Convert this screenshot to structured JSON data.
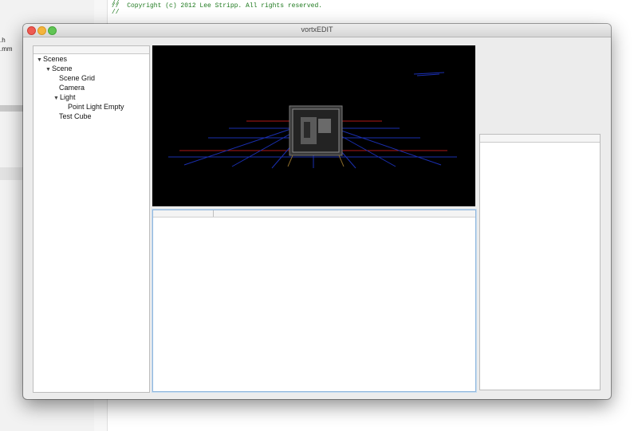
{
  "background_editor": {
    "code_lines": [
      "//",
      "//  Copyright (c) 2012 Lee Stripp. All rights reserved.",
      "//"
    ],
    "sidebar_files": [
      ".h",
      ".mm"
    ]
  },
  "window": {
    "title": "vortxEDIT"
  },
  "outline": {
    "items": [
      {
        "label": "Scenes",
        "expanded": true
      },
      {
        "label": "Scene",
        "expanded": true
      },
      {
        "label": "Scene Grid"
      },
      {
        "label": "Camera"
      },
      {
        "label": "Light",
        "expanded": true
      },
      {
        "label": "Point Light Empty"
      },
      {
        "label": "Test Cube"
      }
    ],
    "disclosure_open": "▼"
  },
  "colors": {
    "viewport_bg": "#000000",
    "grid_red": "#b01818",
    "grid_blue": "#1a2fb0",
    "focus_ring": "#8fb6dd"
  }
}
